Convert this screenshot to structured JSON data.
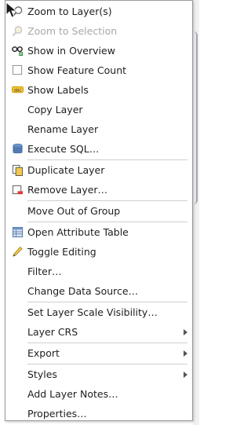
{
  "menu": {
    "items": [
      {
        "id": "zoom-to-layers",
        "label": "Zoom to Layer(s)",
        "icon": "magnifier-icon",
        "disabled": false
      },
      {
        "id": "zoom-to-selection",
        "label": "Zoom to Selection",
        "icon": "magnifier-selection-icon",
        "disabled": true
      },
      {
        "id": "show-in-overview",
        "label": "Show in Overview",
        "icon": "glasses-icon",
        "disabled": false
      },
      {
        "id": "show-feature-count",
        "label": "Show Feature Count",
        "icon": "checkbox-icon",
        "disabled": false
      },
      {
        "id": "show-labels",
        "label": "Show Labels",
        "icon": "labels-icon",
        "icon_text": "abc",
        "disabled": false
      },
      {
        "id": "copy-layer",
        "label": "Copy Layer",
        "icon": "",
        "disabled": false
      },
      {
        "id": "rename-layer",
        "label": "Rename Layer",
        "icon": "",
        "disabled": false
      },
      {
        "id": "execute-sql",
        "label": "Execute SQL…",
        "icon": "database-icon",
        "disabled": false
      },
      {
        "id": "duplicate-layer",
        "label": "Duplicate Layer",
        "icon": "duplicate-layer-icon",
        "disabled": false
      },
      {
        "id": "remove-layer",
        "label": "Remove Layer…",
        "icon": "remove-layer-icon",
        "disabled": false
      },
      {
        "id": "move-out-of-group",
        "label": "Move Out of Group",
        "icon": "",
        "disabled": false
      },
      {
        "id": "open-attribute-table",
        "label": "Open Attribute Table",
        "icon": "table-icon",
        "disabled": false
      },
      {
        "id": "toggle-editing",
        "label": "Toggle Editing",
        "icon": "pencil-icon",
        "disabled": false
      },
      {
        "id": "filter",
        "label": "Filter…",
        "icon": "",
        "disabled": false
      },
      {
        "id": "change-data-source",
        "label": "Change Data Source…",
        "icon": "",
        "disabled": false
      },
      {
        "id": "set-layer-scale-visibility",
        "label": "Set Layer Scale Visibility…",
        "icon": "",
        "disabled": false
      },
      {
        "id": "layer-crs",
        "label": "Layer CRS",
        "icon": "",
        "disabled": false,
        "submenu": true
      },
      {
        "id": "export",
        "label": "Export",
        "icon": "",
        "disabled": false,
        "submenu": true
      },
      {
        "id": "styles",
        "label": "Styles",
        "icon": "",
        "disabled": false,
        "submenu": true
      },
      {
        "id": "add-layer-notes",
        "label": "Add Layer Notes…",
        "icon": "",
        "disabled": false
      },
      {
        "id": "properties",
        "label": "Properties…",
        "icon": "",
        "disabled": false
      }
    ]
  }
}
